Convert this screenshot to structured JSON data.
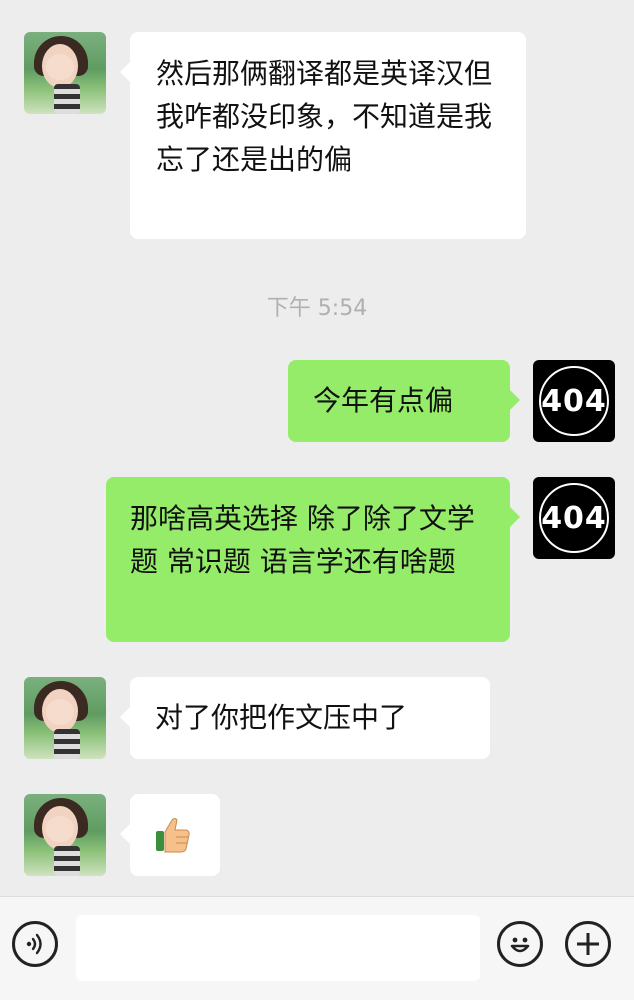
{
  "messages": [
    {
      "sender": "contact",
      "text": "然后那俩翻译都是英译汉但我咋都没印象，不知道是我忘了还是出的偏"
    },
    {
      "sender": "me",
      "text": "今年有点偏"
    },
    {
      "sender": "me",
      "text": "那啥高英选择 除了除了文学题 常识题 语言学还有啥题"
    },
    {
      "sender": "contact",
      "text": "对了你把作文压中了"
    },
    {
      "sender": "contact",
      "sticker": "thumbs-up"
    }
  ],
  "timestamp": "下午 5:54",
  "my_avatar_text": "404",
  "colors": {
    "background": "#ededed",
    "outgoing_bubble": "#95ec69",
    "incoming_bubble": "#ffffff",
    "timestamp": "#b0b0b0"
  },
  "icons": {
    "voice": "voice-icon",
    "emoji": "emoji-icon",
    "more": "plus-icon"
  }
}
